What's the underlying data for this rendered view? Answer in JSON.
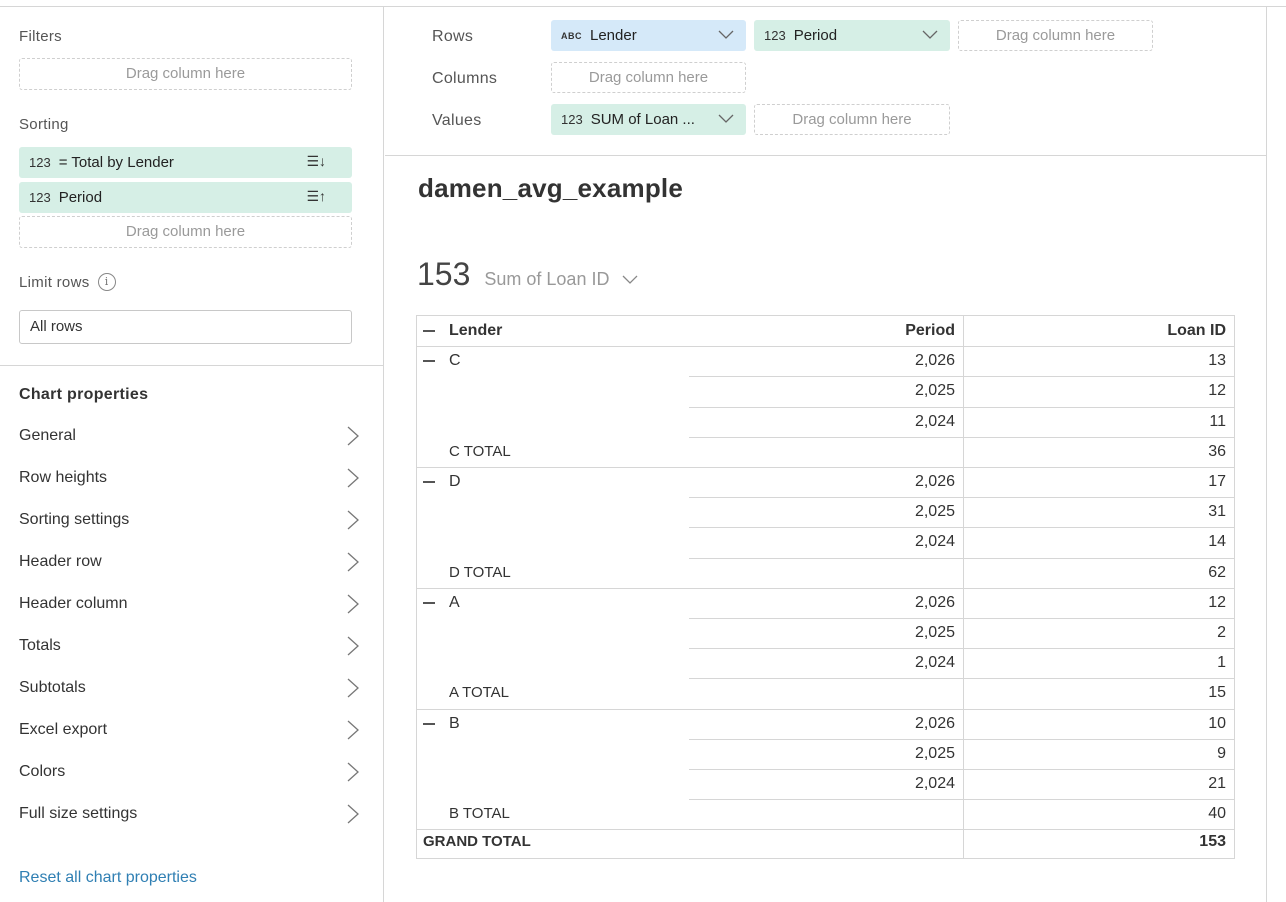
{
  "filters": {
    "label": "Filters",
    "drop_placeholder": "Drag column here"
  },
  "sorting": {
    "label": "Sorting",
    "items": [
      {
        "type": "123",
        "name": "= Total by Lender",
        "direction_icon": "sort-descending-icon",
        "glyph": "☰↓"
      },
      {
        "type": "123",
        "name": "Period",
        "direction_icon": "sort-ascending-icon",
        "glyph": "☰↑"
      }
    ],
    "drop_placeholder": "Drag column here"
  },
  "limit_rows": {
    "label": "Limit rows",
    "info_glyph": "i",
    "value": "All rows"
  },
  "chart_properties": {
    "title": "Chart properties",
    "items": [
      "General",
      "Row heights",
      "Sorting settings",
      "Header row",
      "Header column",
      "Totals",
      "Subtotals",
      "Excel export",
      "Colors",
      "Full size settings"
    ],
    "reset_label": "Reset all chart properties"
  },
  "config": {
    "rows_label": "Rows",
    "columns_label": "Columns",
    "values_label": "Values",
    "rows": [
      {
        "type": "ABC",
        "name": "Lender"
      },
      {
        "type": "123",
        "name": "Period"
      }
    ],
    "values": [
      {
        "type": "123",
        "name": "SUM of Loan ..."
      }
    ],
    "drop_placeholder": "Drag column here"
  },
  "dataset_title": "damen_avg_example",
  "kpi": {
    "value": "153",
    "label": "Sum of Loan ID"
  },
  "table": {
    "headers": {
      "lender": "Lender",
      "period": "Period",
      "value": "Loan ID"
    },
    "groups": [
      {
        "lender": "C",
        "rows": [
          {
            "period": "2,026",
            "value": "13"
          },
          {
            "period": "2,025",
            "value": "12"
          },
          {
            "period": "2,024",
            "value": "11"
          }
        ],
        "total_label": "C TOTAL",
        "total": "36"
      },
      {
        "lender": "D",
        "rows": [
          {
            "period": "2,026",
            "value": "17"
          },
          {
            "period": "2,025",
            "value": "31"
          },
          {
            "period": "2,024",
            "value": "14"
          }
        ],
        "total_label": "D TOTAL",
        "total": "62"
      },
      {
        "lender": "A",
        "rows": [
          {
            "period": "2,026",
            "value": "12"
          },
          {
            "period": "2,025",
            "value": "2"
          },
          {
            "period": "2,024",
            "value": "1"
          }
        ],
        "total_label": "A TOTAL",
        "total": "15"
      },
      {
        "lender": "B",
        "rows": [
          {
            "period": "2,026",
            "value": "10"
          },
          {
            "period": "2,025",
            "value": "9"
          },
          {
            "period": "2,024",
            "value": "21"
          }
        ],
        "total_label": "B TOTAL",
        "total": "40"
      }
    ],
    "grand_total_label": "GRAND TOTAL",
    "grand_total": "153"
  }
}
